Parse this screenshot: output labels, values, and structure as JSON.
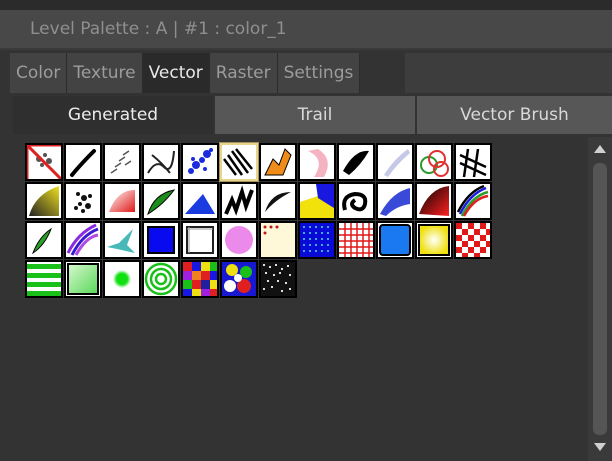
{
  "window": {
    "title": "Level Palette : A | #1 : color_1"
  },
  "tabs": [
    {
      "label": "Color",
      "active": false
    },
    {
      "label": "Texture",
      "active": false
    },
    {
      "label": "Vector",
      "active": true
    },
    {
      "label": "Raster",
      "active": false
    },
    {
      "label": "Settings",
      "active": false
    }
  ],
  "subtabs": [
    {
      "label": "Generated",
      "active": true
    },
    {
      "label": "Trail",
      "active": false
    },
    {
      "label": "Vector Brush",
      "active": false
    }
  ],
  "styles": [
    {
      "name": "none-style-icon",
      "selected": false
    },
    {
      "name": "dark-stroke-icon",
      "selected": false
    },
    {
      "name": "dashed-strokes-icon",
      "selected": false
    },
    {
      "name": "knotted-line-icon",
      "selected": false
    },
    {
      "name": "blue-dots-icon",
      "selected": false
    },
    {
      "name": "striped-diagonal-icon",
      "selected": true
    },
    {
      "name": "orange-ribbon-icon",
      "selected": false
    },
    {
      "name": "pink-ribbon-icon",
      "selected": false
    },
    {
      "name": "black-ink-icon",
      "selected": false
    },
    {
      "name": "lavender-brush-icon",
      "selected": false
    },
    {
      "name": "green-red-rings-icon",
      "selected": false
    },
    {
      "name": "crosshatch-icon",
      "selected": false
    },
    {
      "name": "yellow-gradient-icon",
      "selected": false
    },
    {
      "name": "speckle-black-icon",
      "selected": false
    },
    {
      "name": "red-fade-icon",
      "selected": false
    },
    {
      "name": "green-leaf-icon",
      "selected": false
    },
    {
      "name": "blue-triangle-icon",
      "selected": false
    },
    {
      "name": "zigzag-black-icon",
      "selected": false
    },
    {
      "name": "black-curve-icon",
      "selected": false
    },
    {
      "name": "yellow-blue-icon",
      "selected": false
    },
    {
      "name": "spiral-icon",
      "selected": false
    },
    {
      "name": "blue-brush-icon",
      "selected": false
    },
    {
      "name": "red-black-gradient-icon",
      "selected": false
    },
    {
      "name": "multicolor-lines-icon",
      "selected": false
    },
    {
      "name": "green-leaf-small-icon",
      "selected": false
    },
    {
      "name": "purple-stripes-icon",
      "selected": false
    },
    {
      "name": "teal-brush-icon",
      "selected": false
    },
    {
      "name": "blue-square-icon",
      "selected": false
    },
    {
      "name": "white-square-icon",
      "selected": false
    },
    {
      "name": "pink-circle-icon",
      "selected": false
    },
    {
      "name": "cream-square-icon",
      "selected": false
    },
    {
      "name": "blue-dot-pattern-icon",
      "selected": false
    },
    {
      "name": "red-grid-icon",
      "selected": false
    },
    {
      "name": "blue-fill-icon",
      "selected": false
    },
    {
      "name": "yellow-fill-icon",
      "selected": false
    },
    {
      "name": "red-check-icon",
      "selected": false
    },
    {
      "name": "green-stripes-icon",
      "selected": false
    },
    {
      "name": "green-square-icon",
      "selected": false
    },
    {
      "name": "green-dot-icon",
      "selected": false
    },
    {
      "name": "green-rings-icon",
      "selected": false
    },
    {
      "name": "color-mosaic-icon",
      "selected": false
    },
    {
      "name": "color-blobs-icon",
      "selected": false
    },
    {
      "name": "noise-icon",
      "selected": false
    }
  ],
  "colors": {
    "panel_bg": "#333333",
    "title_bg": "#484848",
    "tab_bg": "#434343",
    "tab_active_bg": "#2a2a2a",
    "subtab_bg": "#575757",
    "subtab_active_bg": "#2f2f2f",
    "selected_border": "#e8d48b"
  }
}
